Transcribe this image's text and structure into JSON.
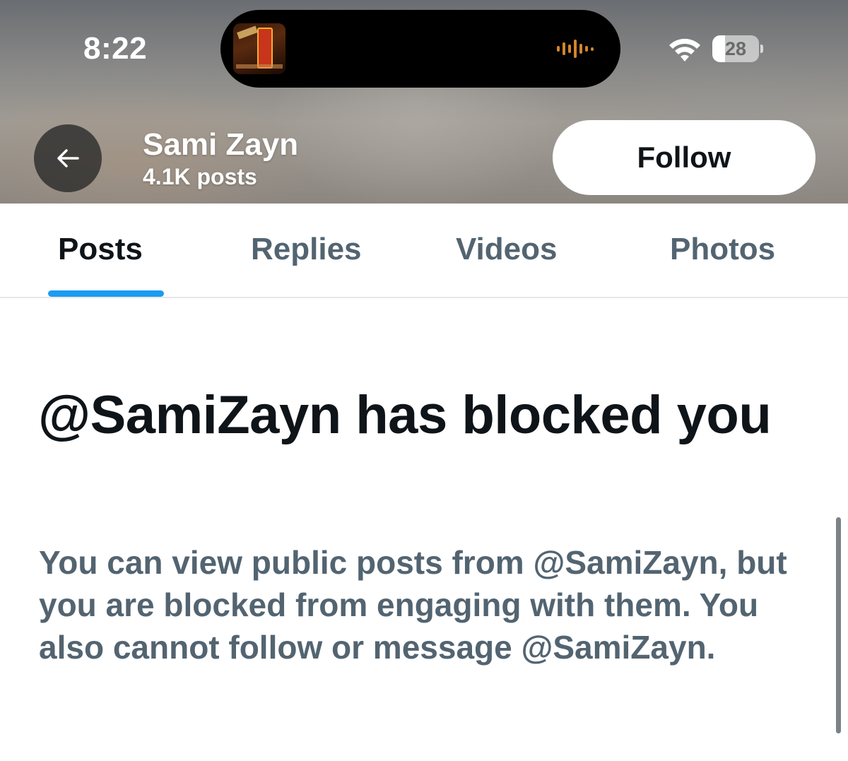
{
  "status_bar": {
    "time": "8:22",
    "battery": "28",
    "battery_level_percent": 28,
    "icons": [
      "wifi-icon",
      "battery-icon",
      "audio-waveform-icon",
      "now-playing-album-art"
    ]
  },
  "header": {
    "name": "Sami Zayn",
    "post_count": "4.1K posts",
    "back_icon": "arrow-left-icon",
    "follow_label": "Follow"
  },
  "tabs": [
    {
      "label": "Posts",
      "active": true
    },
    {
      "label": "Replies",
      "active": false
    },
    {
      "label": "Videos",
      "active": false
    },
    {
      "label": "Photos",
      "active": false
    }
  ],
  "blocked_notice": {
    "headline": "@SamiZayn has blocked you",
    "body": "You can view public posts from @SamiZayn, but you are blocked from engaging with them. You also cannot follow or message @SamiZayn."
  },
  "colors": {
    "accent": "#1d9bf0",
    "primary_text": "#0f1419",
    "secondary_text": "#536471",
    "waveform": "#d2852c"
  }
}
